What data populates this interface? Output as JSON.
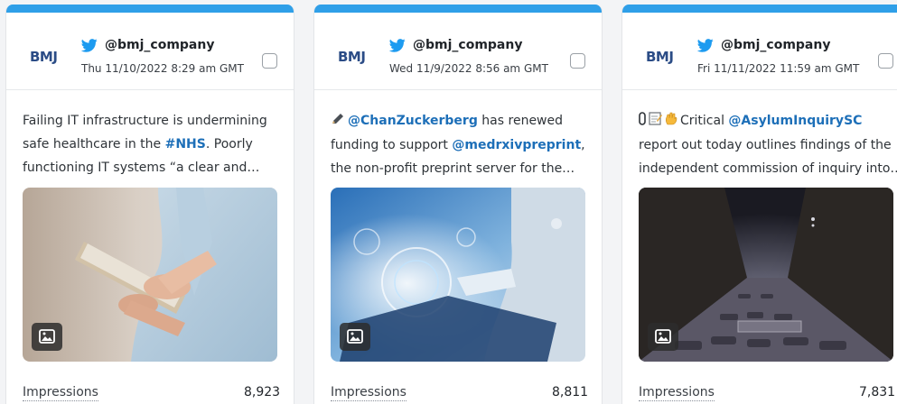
{
  "cards": [
    {
      "logo": "BMJ",
      "handle": "@bmj_company",
      "date": "Thu 11/10/2022 8:29 am GMT",
      "text_lines": [
        [
          {
            "t": "Failing IT infrastructure is undermining"
          }
        ],
        [
          {
            "t": "safe healthcare in the "
          },
          {
            "t": "#NHS",
            "link": true
          },
          {
            "t": ". Poorly"
          }
        ],
        [
          {
            "t": "functioning IT systems “a clear and…"
          }
        ]
      ],
      "media_icon": "image-icon",
      "metric_label": "Impressions",
      "metric_value": "8,923"
    },
    {
      "logo": "BMJ",
      "handle": "@bmj_company",
      "date": "Wed 11/9/2022 8:56 am GMT",
      "text_lines": [
        [
          {
            "emoji": "pencil-icon"
          },
          {
            "t": "@ChanZuckerberg",
            "link": true
          },
          {
            "t": " has renewed"
          }
        ],
        [
          {
            "t": "funding to support "
          },
          {
            "t": "@medrxivpreprint",
            "link": true
          },
          {
            "t": ","
          }
        ],
        [
          {
            "t": "the non-profit preprint server for the…"
          }
        ]
      ],
      "media_icon": "image-icon",
      "metric_label": "Impressions",
      "metric_value": "8,811"
    },
    {
      "logo": "BMJ",
      "handle": "@bmj_company",
      "date": "Fri 11/11/2022 11:59 am GMT",
      "text_lines": [
        [
          {
            "emoji": "paperclip-icon"
          },
          {
            "emoji": "memo-icon"
          },
          {
            "emoji": "hand-icon"
          },
          {
            "t": "Critical "
          },
          {
            "t": "@AsylumInquirySC",
            "link": true
          }
        ],
        [
          {
            "t": "report out today outlines findings of the"
          }
        ],
        [
          {
            "t": "independent commission of inquiry into…"
          }
        ]
      ],
      "media_icon": "image-icon",
      "metric_label": "Impressions",
      "metric_value": "7,831"
    }
  ],
  "colors": {
    "accent": "#2f9fe8",
    "twitter": "#1d9bf0",
    "link": "#1d6fb8",
    "logo": "#2b4c86"
  }
}
